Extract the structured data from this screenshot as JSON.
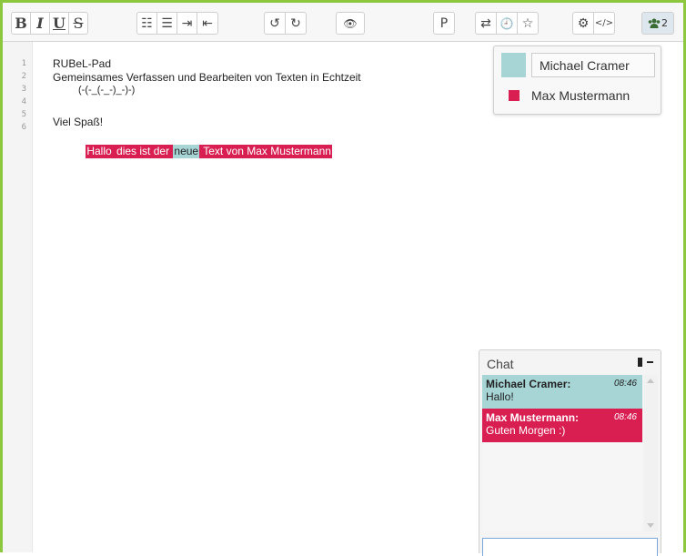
{
  "toolbar": {
    "bold": "B",
    "italic": "I",
    "underline": "U",
    "strike": "S",
    "ordered_list": "☷",
    "unordered_list": "☰",
    "indent": "⇥",
    "outdent": "⇤",
    "undo": "↺",
    "redo": "↻",
    "visibility": "👁",
    "paragraph": "P",
    "sync": "⇄",
    "history": "🕘",
    "star": "☆",
    "settings": "⚙",
    "embed": "</>",
    "users_count": "2"
  },
  "editor": {
    "line_numbers": [
      "1",
      "2",
      "3",
      "4",
      "5",
      "6"
    ],
    "lines": [
      "RUBeL-Pad",
      "Gemeinsames Verfassen und Bearbeiten von Texten in Echtzeit",
      "(-(-_(-_-)_-)-)",
      "",
      "Viel Spaß!"
    ],
    "line6": {
      "indent": "          ",
      "segments": [
        {
          "text": "Hallo",
          "author": "red"
        },
        {
          "text": " dies ist der ",
          "author": "red"
        },
        {
          "text": "neue",
          "author": "teal"
        },
        {
          "text": " Text von Max Mustermann",
          "author": "red"
        }
      ]
    }
  },
  "users": {
    "self_name": "Michael Cramer",
    "self_color": "#a7d5d6",
    "other_name": "Max Mustermann",
    "other_color": "#d91f52"
  },
  "chat": {
    "title": "Chat",
    "messages": [
      {
        "author": "Michael Cramer:",
        "time": "08:46",
        "text": "Hallo!",
        "color": "teal"
      },
      {
        "author": "Max Mustermann:",
        "time": "08:46",
        "text": "Guten Morgen :)",
        "color": "red"
      }
    ]
  },
  "colors": {
    "accent_border": "#8dc63f"
  }
}
